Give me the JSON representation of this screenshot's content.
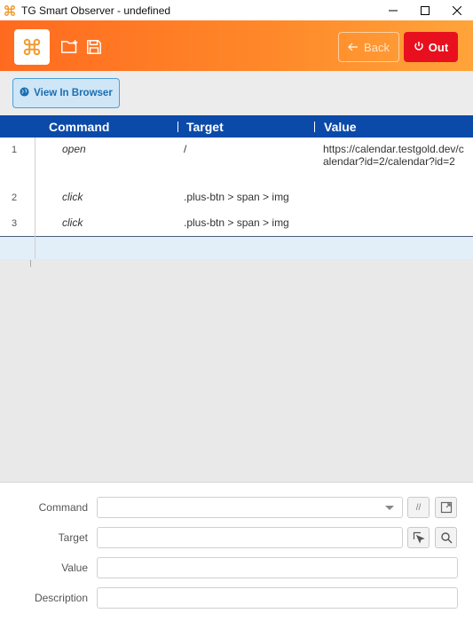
{
  "window": {
    "title": "TG Smart Observer - undefined"
  },
  "header": {
    "back_label": "Back",
    "out_label": "Out"
  },
  "toolbar": {
    "view_in_browser_label": "View In Browser"
  },
  "table": {
    "columns": [
      "Command",
      "Target",
      "Value"
    ],
    "rows": [
      {
        "num": "1",
        "command": "open",
        "target": "/",
        "value": "https://calendar.testgold.dev/calendar?id=2/calendar?id=2"
      },
      {
        "num": "2",
        "command": "click",
        "target": ".plus-btn > span > img",
        "value": ""
      },
      {
        "num": "3",
        "command": "click",
        "target": ".plus-btn > span > img",
        "value": ""
      }
    ]
  },
  "form": {
    "command_label": "Command",
    "target_label": "Target",
    "value_label": "Value",
    "description_label": "Description",
    "command_value": "",
    "target_value": "",
    "value_value": "",
    "description_value": "",
    "comment_toggle_label": "//"
  },
  "colors": {
    "header_gradient_start": "#ff6a1f",
    "header_gradient_end": "#ffa43a",
    "out_button": "#e8101e",
    "table_header": "#0b4aa8",
    "view_button_bg": "#cfe6f7",
    "view_button_text": "#1a6fb0"
  },
  "icons": {
    "app": "command-key-icon",
    "new_folder": "folder-plus-icon",
    "save": "save-icon",
    "back": "arrow-left-icon",
    "out": "power-icon",
    "view": "globe-icon",
    "open_external": "open-external-icon",
    "select_target": "select-target-icon",
    "find": "search-icon"
  }
}
